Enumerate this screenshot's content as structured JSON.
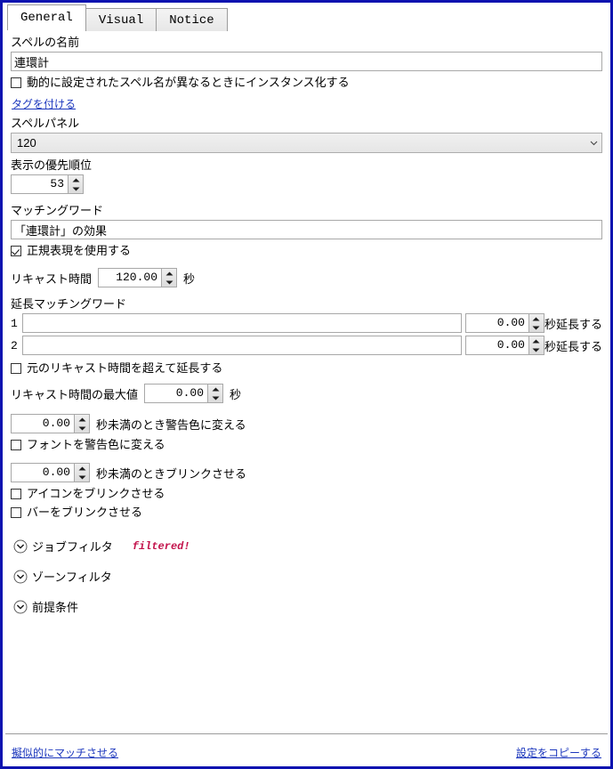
{
  "tabs": [
    {
      "label": "General",
      "active": true
    },
    {
      "label": "Visual",
      "active": false
    },
    {
      "label": "Notice",
      "active": false
    }
  ],
  "general": {
    "spell_name_label": "スペルの名前",
    "spell_name_value": "連環計",
    "instance_checkbox_label": "動的に設定されたスペル名が異なるときにインスタンス化する",
    "tag_link": "タグを付ける",
    "panel_label": "スペルパネル",
    "panel_value": "120",
    "priority_label": "表示の優先順位",
    "priority_value": "53",
    "matching_word_label": "マッチングワード",
    "matching_word_value": "「連環計」の効果",
    "regex_checkbox_label": "正規表現を使用する",
    "recast_label": "リキャスト時間",
    "recast_value": "120.00",
    "recast_unit": "秒",
    "extend_group_label": "延長マッチングワード",
    "extend_rows": [
      {
        "num": "1",
        "word": "",
        "seconds": "0.00",
        "suffix": "秒延長する"
      },
      {
        "num": "2",
        "word": "",
        "seconds": "0.00",
        "suffix": "秒延長する"
      }
    ],
    "extend_over_checkbox_label": "元のリキャスト時間を超えて延長する",
    "max_recast_label": "リキャスト時間の最大値",
    "max_recast_value": "0.00",
    "max_recast_unit": "秒",
    "warn_color_value": "0.00",
    "warn_color_suffix": "秒未満のとき警告色に変える",
    "warn_font_checkbox_label": "フォントを警告色に変える",
    "blink_value": "0.00",
    "blink_suffix": "秒未満のときブリンクさせる",
    "blink_icon_checkbox_label": "アイコンをブリンクさせる",
    "blink_bar_checkbox_label": "バーをブリンクさせる"
  },
  "sections": [
    {
      "title": "ジョブフィルタ",
      "tag": "filtered!"
    },
    {
      "title": "ゾーンフィルタ",
      "tag": ""
    },
    {
      "title": "前提条件",
      "tag": ""
    }
  ],
  "footer": {
    "left_link": "擬似的にマッチさせる",
    "right_link": "設定をコピーする"
  },
  "colors": {
    "window_border": "#0b13b0",
    "link": "#1c37bd",
    "filtered_tag": "#c3124b"
  }
}
